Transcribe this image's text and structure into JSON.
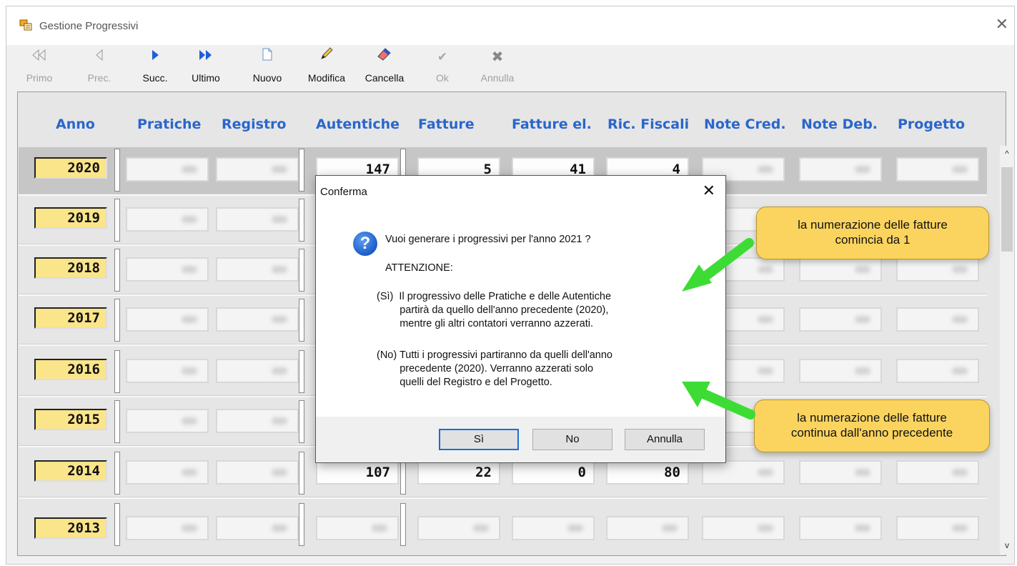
{
  "window": {
    "title": "Gestione Progressivi",
    "close": "✕"
  },
  "toolbar": [
    {
      "label": "Primo",
      "icon": "first-icon",
      "enabled": false
    },
    {
      "label": "Prec.",
      "icon": "prev-icon",
      "enabled": false
    },
    {
      "label": "Succ.",
      "icon": "next-icon",
      "enabled": true
    },
    {
      "label": "Ultimo",
      "icon": "last-icon",
      "enabled": true
    },
    {
      "label": "Nuovo",
      "icon": "new-icon",
      "enabled": true
    },
    {
      "label": "Modifica",
      "icon": "edit-icon",
      "enabled": true
    },
    {
      "label": "Cancella",
      "icon": "delete-icon",
      "enabled": true
    },
    {
      "label": "Ok",
      "icon": "check-icon",
      "enabled": false
    },
    {
      "label": "Annulla",
      "icon": "cancel-icon",
      "enabled": false
    }
  ],
  "grid": {
    "headers": [
      "Anno",
      "Pratiche",
      "Registro",
      "Autentiche",
      "Fatture",
      "Fatture el.",
      "Ric. Fiscali",
      "Note Cred.",
      "Note Deb.",
      "Progetto"
    ],
    "rows": [
      {
        "year": "2020",
        "autentiche": "147",
        "fatture": "5",
        "fatture_el": "41",
        "ric_fiscali": "4"
      },
      {
        "year": "2019"
      },
      {
        "year": "2018"
      },
      {
        "year": "2017"
      },
      {
        "year": "2016"
      },
      {
        "year": "2015"
      },
      {
        "year": "2014",
        "autentiche": "107",
        "fatture": "22",
        "fatture_el": "0",
        "ric_fiscali": "80"
      },
      {
        "year": "2013"
      }
    ]
  },
  "dialog": {
    "title": "Conferma",
    "close": "✕",
    "question": "Vuoi generare i progressivi per l'anno 2021 ?",
    "attention": "ATTENZIONE:",
    "si_text": "(Sì)  Il progressivo delle Pratiche e delle Autentiche\n        partirà da quello dell'anno precedente (2020),\n        mentre gli altri contatori verranno azzerati.",
    "no_text": "(No) Tutti i progressivi partiranno da quelli dell'anno\n        precedente (2020). Verranno azzerati solo\n        quelli del Registro e del Progetto.",
    "buttons": {
      "yes": "Sì",
      "no": "No",
      "cancel": "Annulla"
    }
  },
  "callouts": {
    "top": "la numerazione delle fatture\ncomincia da 1",
    "bottom": "la numerazione delle fatture\ncontinua dall'anno precedente"
  },
  "colors": {
    "header_blue": "#2a66cc",
    "year_yellow": "#fbe58a",
    "callout": "#fbd45f",
    "arrow": "#3ddc35"
  }
}
